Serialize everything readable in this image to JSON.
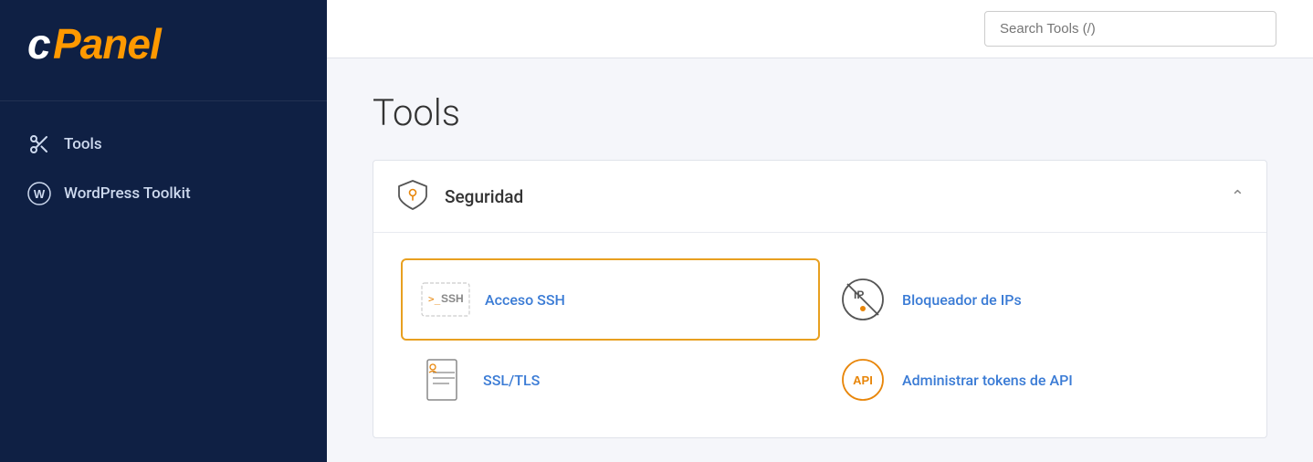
{
  "sidebar": {
    "logo": "cPanel",
    "nav_items": [
      {
        "id": "tools",
        "label": "Tools",
        "icon": "tools-icon"
      },
      {
        "id": "wordpress-toolkit",
        "label": "WordPress Toolkit",
        "icon": "wordpress-icon"
      }
    ]
  },
  "header": {
    "search_placeholder": "Search Tools (/)"
  },
  "main": {
    "page_title": "Tools",
    "sections": [
      {
        "id": "seguridad",
        "title": "Seguridad",
        "expanded": true,
        "tools": [
          {
            "id": "acceso-ssh",
            "label": "Acceso SSH",
            "active": true
          },
          {
            "id": "bloqueador-ips",
            "label": "Bloqueador de IPs",
            "active": false
          },
          {
            "id": "ssl-tls",
            "label": "SSL/TLS",
            "active": false
          },
          {
            "id": "api-tokens",
            "label": "Administrar tokens de API",
            "active": false
          }
        ]
      }
    ]
  },
  "colors": {
    "sidebar_bg": "#0f2044",
    "accent_orange": "#e8860a",
    "link_blue": "#3a7bd5",
    "active_border": "#e8a020"
  }
}
